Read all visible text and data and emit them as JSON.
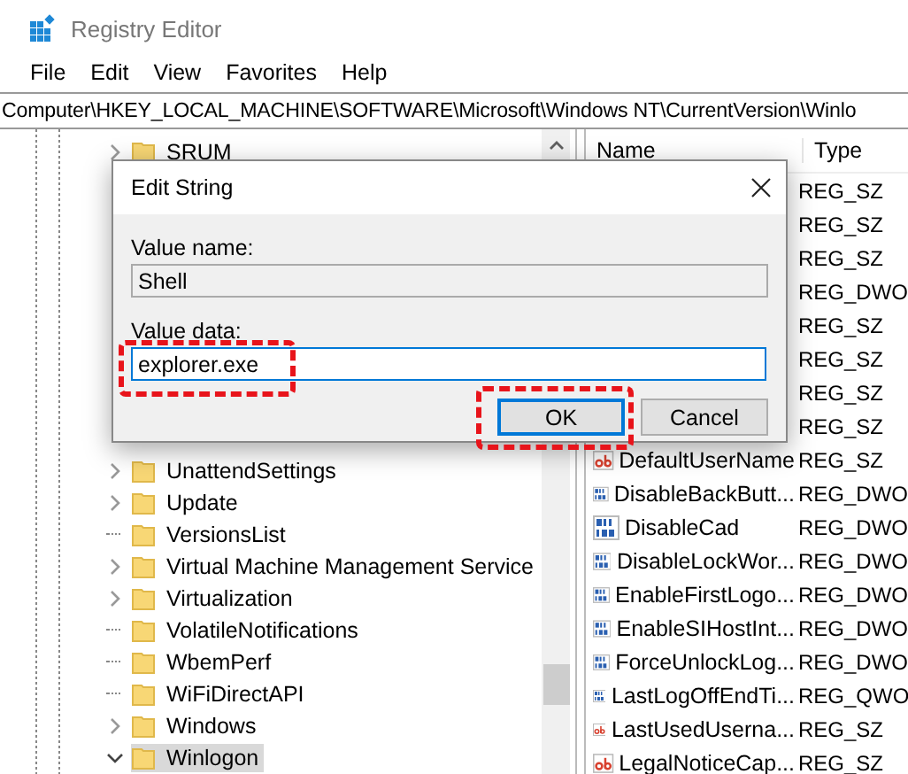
{
  "window": {
    "title": "Registry Editor"
  },
  "menu": [
    {
      "label": "File"
    },
    {
      "label": "Edit"
    },
    {
      "label": "View"
    },
    {
      "label": "Favorites"
    },
    {
      "label": "Help"
    }
  ],
  "address": "Computer\\HKEY_LOCAL_MACHINE\\SOFTWARE\\Microsoft\\Windows NT\\CurrentVersion\\Winlo",
  "tree": {
    "items": [
      {
        "label": "SRUM",
        "expandable": true,
        "expanded": false,
        "selected": false
      },
      {
        "label": "UnattendSettings",
        "expandable": true,
        "expanded": false,
        "selected": false
      },
      {
        "label": "Update",
        "expandable": true,
        "expanded": false,
        "selected": false
      },
      {
        "label": "VersionsList",
        "expandable": false,
        "selected": false
      },
      {
        "label": "Virtual Machine Management Service",
        "expandable": true,
        "expanded": false,
        "selected": false
      },
      {
        "label": "Virtualization",
        "expandable": true,
        "expanded": false,
        "selected": false
      },
      {
        "label": "VolatileNotifications",
        "expandable": false,
        "selected": false
      },
      {
        "label": "WbemPerf",
        "expandable": false,
        "selected": false
      },
      {
        "label": "WiFiDirectAPI",
        "expandable": false,
        "selected": false
      },
      {
        "label": "Windows",
        "expandable": true,
        "expanded": false,
        "selected": false
      },
      {
        "label": "Winlogon",
        "expandable": true,
        "expanded": true,
        "selected": true
      }
    ]
  },
  "values": {
    "columns": [
      "Name",
      "Type"
    ],
    "rows": [
      {
        "type": "REG_SZ"
      },
      {
        "type": "REG_SZ"
      },
      {
        "type": "REG_SZ"
      },
      {
        "type": "REG_DWO"
      },
      {
        "type": "REG_SZ"
      },
      {
        "type": "REG_SZ"
      },
      {
        "type": "REG_SZ"
      },
      {
        "type": "REG_SZ"
      },
      {
        "name": "DefaultUserName",
        "kind": "string",
        "type": "REG_SZ"
      },
      {
        "name": "DisableBackButt...",
        "kind": "number",
        "type": "REG_DWO"
      },
      {
        "name": "DisableCad",
        "kind": "number",
        "type": "REG_DWO"
      },
      {
        "name": "DisableLockWor...",
        "kind": "number",
        "type": "REG_DWO"
      },
      {
        "name": "EnableFirstLogo...",
        "kind": "number",
        "type": "REG_DWO"
      },
      {
        "name": "EnableSIHostInt...",
        "kind": "number",
        "type": "REG_DWO"
      },
      {
        "name": "ForceUnlockLog...",
        "kind": "number",
        "type": "REG_DWO"
      },
      {
        "name": "LastLogOffEndTi...",
        "kind": "number",
        "type": "REG_QWO"
      },
      {
        "name": "LastUsedUserna...",
        "kind": "string",
        "type": "REG_SZ"
      },
      {
        "name": "LegalNoticeCap...",
        "kind": "string",
        "type": "REG_SZ"
      }
    ]
  },
  "dialog": {
    "title": "Edit String",
    "value_name_label": "Value name:",
    "value_name": "Shell",
    "value_data_label": "Value data:",
    "value_data": "explorer.exe",
    "value_data_highlighted": true,
    "buttons": [
      {
        "label": "OK",
        "default": true,
        "highlighted": true
      },
      {
        "label": "Cancel",
        "default": false,
        "highlighted": false
      }
    ]
  }
}
